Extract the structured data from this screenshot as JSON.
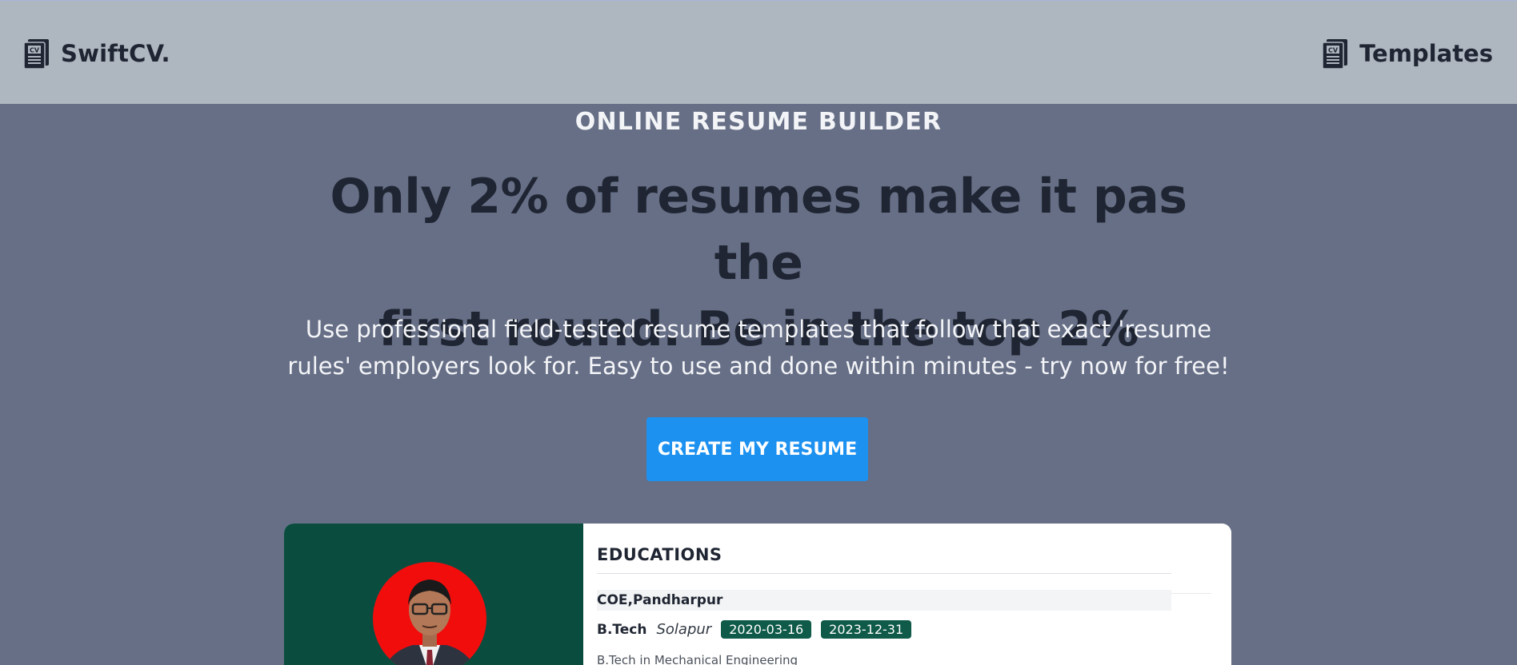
{
  "nav": {
    "brand": "SwiftCV.",
    "templates": "Templates",
    "icon": "cv-document-icon"
  },
  "hero": {
    "eyebrow": "ONLINE RESUME BUILDER",
    "headline_line1": "Only 2% of resumes make it pas the",
    "headline_line2": "first round. Be in the top 2%",
    "subtext_line1": "Use professional field-tested resume templates that follow that exact 'resume",
    "subtext_line2": "rules' employers look for. Easy to use and done within minutes - try now for free!",
    "cta": "CREATE MY RESUME"
  },
  "preview": {
    "section_title": "EDUCATIONS",
    "institution": "COE,Pandharpur",
    "degree": "B.Tech",
    "city": "Solapur",
    "start_date": "2020-03-16",
    "end_date": "2023-12-31",
    "description": "B.Tech in Mechanical Engineering"
  },
  "colors": {
    "page_bg": "#666f86",
    "navbar_bg": "#aeb6c0",
    "cta_bg": "#1d91f0",
    "sidebar_bg": "#0a4d3f",
    "tag_bg": "#0f5a49",
    "photo_bg": "#f20d0d"
  }
}
